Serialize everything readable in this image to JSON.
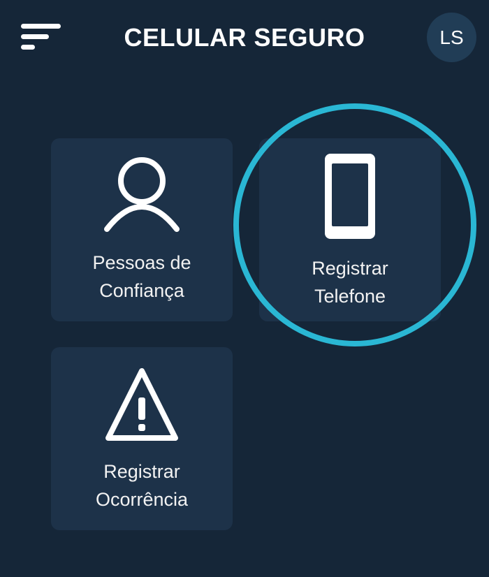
{
  "header": {
    "title": "CELULAR SEGURO",
    "avatar_initials": "LS",
    "menu_icon": "hamburger-menu-icon"
  },
  "cards": [
    {
      "line1": "Pessoas de",
      "line2": "Confiança",
      "icon": "person-icon"
    },
    {
      "line1": "Registrar",
      "line2": "Telefone",
      "icon": "smartphone-icon"
    },
    {
      "line1": "Registrar",
      "line2": "Ocorrência",
      "icon": "warning-triangle-icon"
    }
  ],
  "colors": {
    "background": "#152638",
    "card": "#1d3249",
    "highlight": "#2ab7d4",
    "text": "#ffffff"
  }
}
